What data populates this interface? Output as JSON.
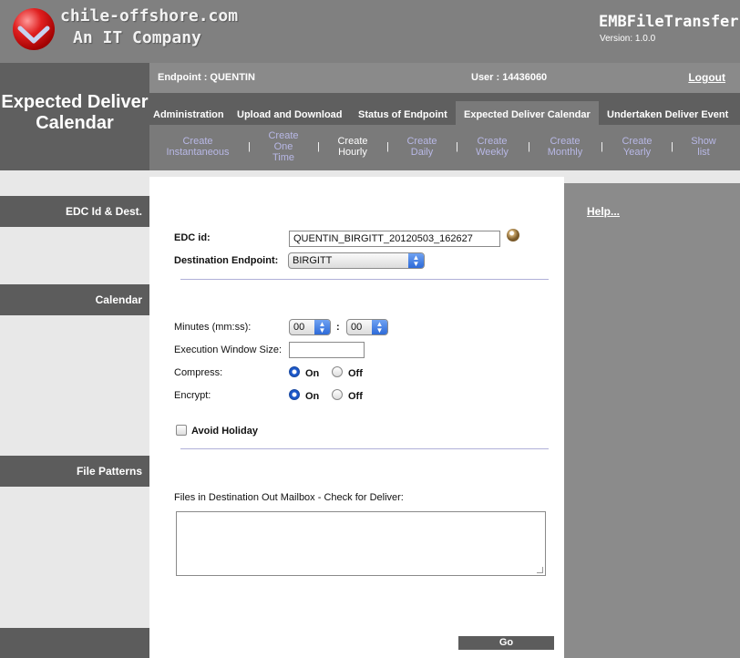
{
  "brand": {
    "line1": "chile-offshore.com",
    "line2": "An IT Company"
  },
  "app": {
    "title": "EMBFileTransfer",
    "version": "Version: 1.0.0"
  },
  "page_title": "Expected Deliver Calendar",
  "info": {
    "endpoint": "Endpoint : QUENTIN",
    "user": "User : 14436060",
    "logout": "Logout"
  },
  "nav": {
    "tabs": [
      "Administration",
      "Upload and Download",
      "Status of Endpoint",
      "Expected Deliver Calendar",
      "Undertaken Deliver Event"
    ],
    "active_index": 3
  },
  "subnav": {
    "items": [
      {
        "l1": "Create",
        "l2": "Instantaneous",
        "l3": ""
      },
      {
        "l1": "Create",
        "l2": "One",
        "l3": "Time"
      },
      {
        "l1": "Create",
        "l2": "Hourly",
        "l3": ""
      },
      {
        "l1": "Create",
        "l2": "Daily",
        "l3": ""
      },
      {
        "l1": "Create",
        "l2": "Weekly",
        "l3": ""
      },
      {
        "l1": "Create",
        "l2": "Monthly",
        "l3": ""
      },
      {
        "l1": "Create",
        "l2": "Yearly",
        "l3": ""
      },
      {
        "l1": "Show",
        "l2": "list",
        "l3": ""
      }
    ],
    "separator": "|",
    "current_index": 2
  },
  "sidebar": {
    "sections": [
      "EDC Id & Dest.",
      "Calendar",
      "File Patterns"
    ]
  },
  "form": {
    "edc_id_label": "EDC id:",
    "edc_id_value": "QUENTIN_BIRGITT_20120503_162627",
    "dest_label": "Destination Endpoint:",
    "dest_value": "BIRGITT",
    "minutes_label": "Minutes (mm:ss):",
    "minutes_mm": "00",
    "minutes_ss": "00",
    "minutes_sep": ":",
    "exec_window_label": "Execution Window Size:",
    "exec_window_value": "",
    "compress_label": "Compress:",
    "encrypt_label": "Encrypt:",
    "on_label": "On",
    "off_label": "Off",
    "compress": "On",
    "encrypt": "On",
    "avoid_holiday_label": "Avoid Holiday",
    "avoid_holiday_checked": false,
    "files_label": "Files in Destination Out Mailbox - Check for Deliver:",
    "files_value": "",
    "go_label": "Go"
  },
  "right_panel": {
    "help": "Help..."
  },
  "colors": {
    "header_bg": "#808080",
    "band_bg": "#5f5f5f",
    "subnav_link": "#b8b8e6",
    "radio_on": "#1b57c9"
  }
}
